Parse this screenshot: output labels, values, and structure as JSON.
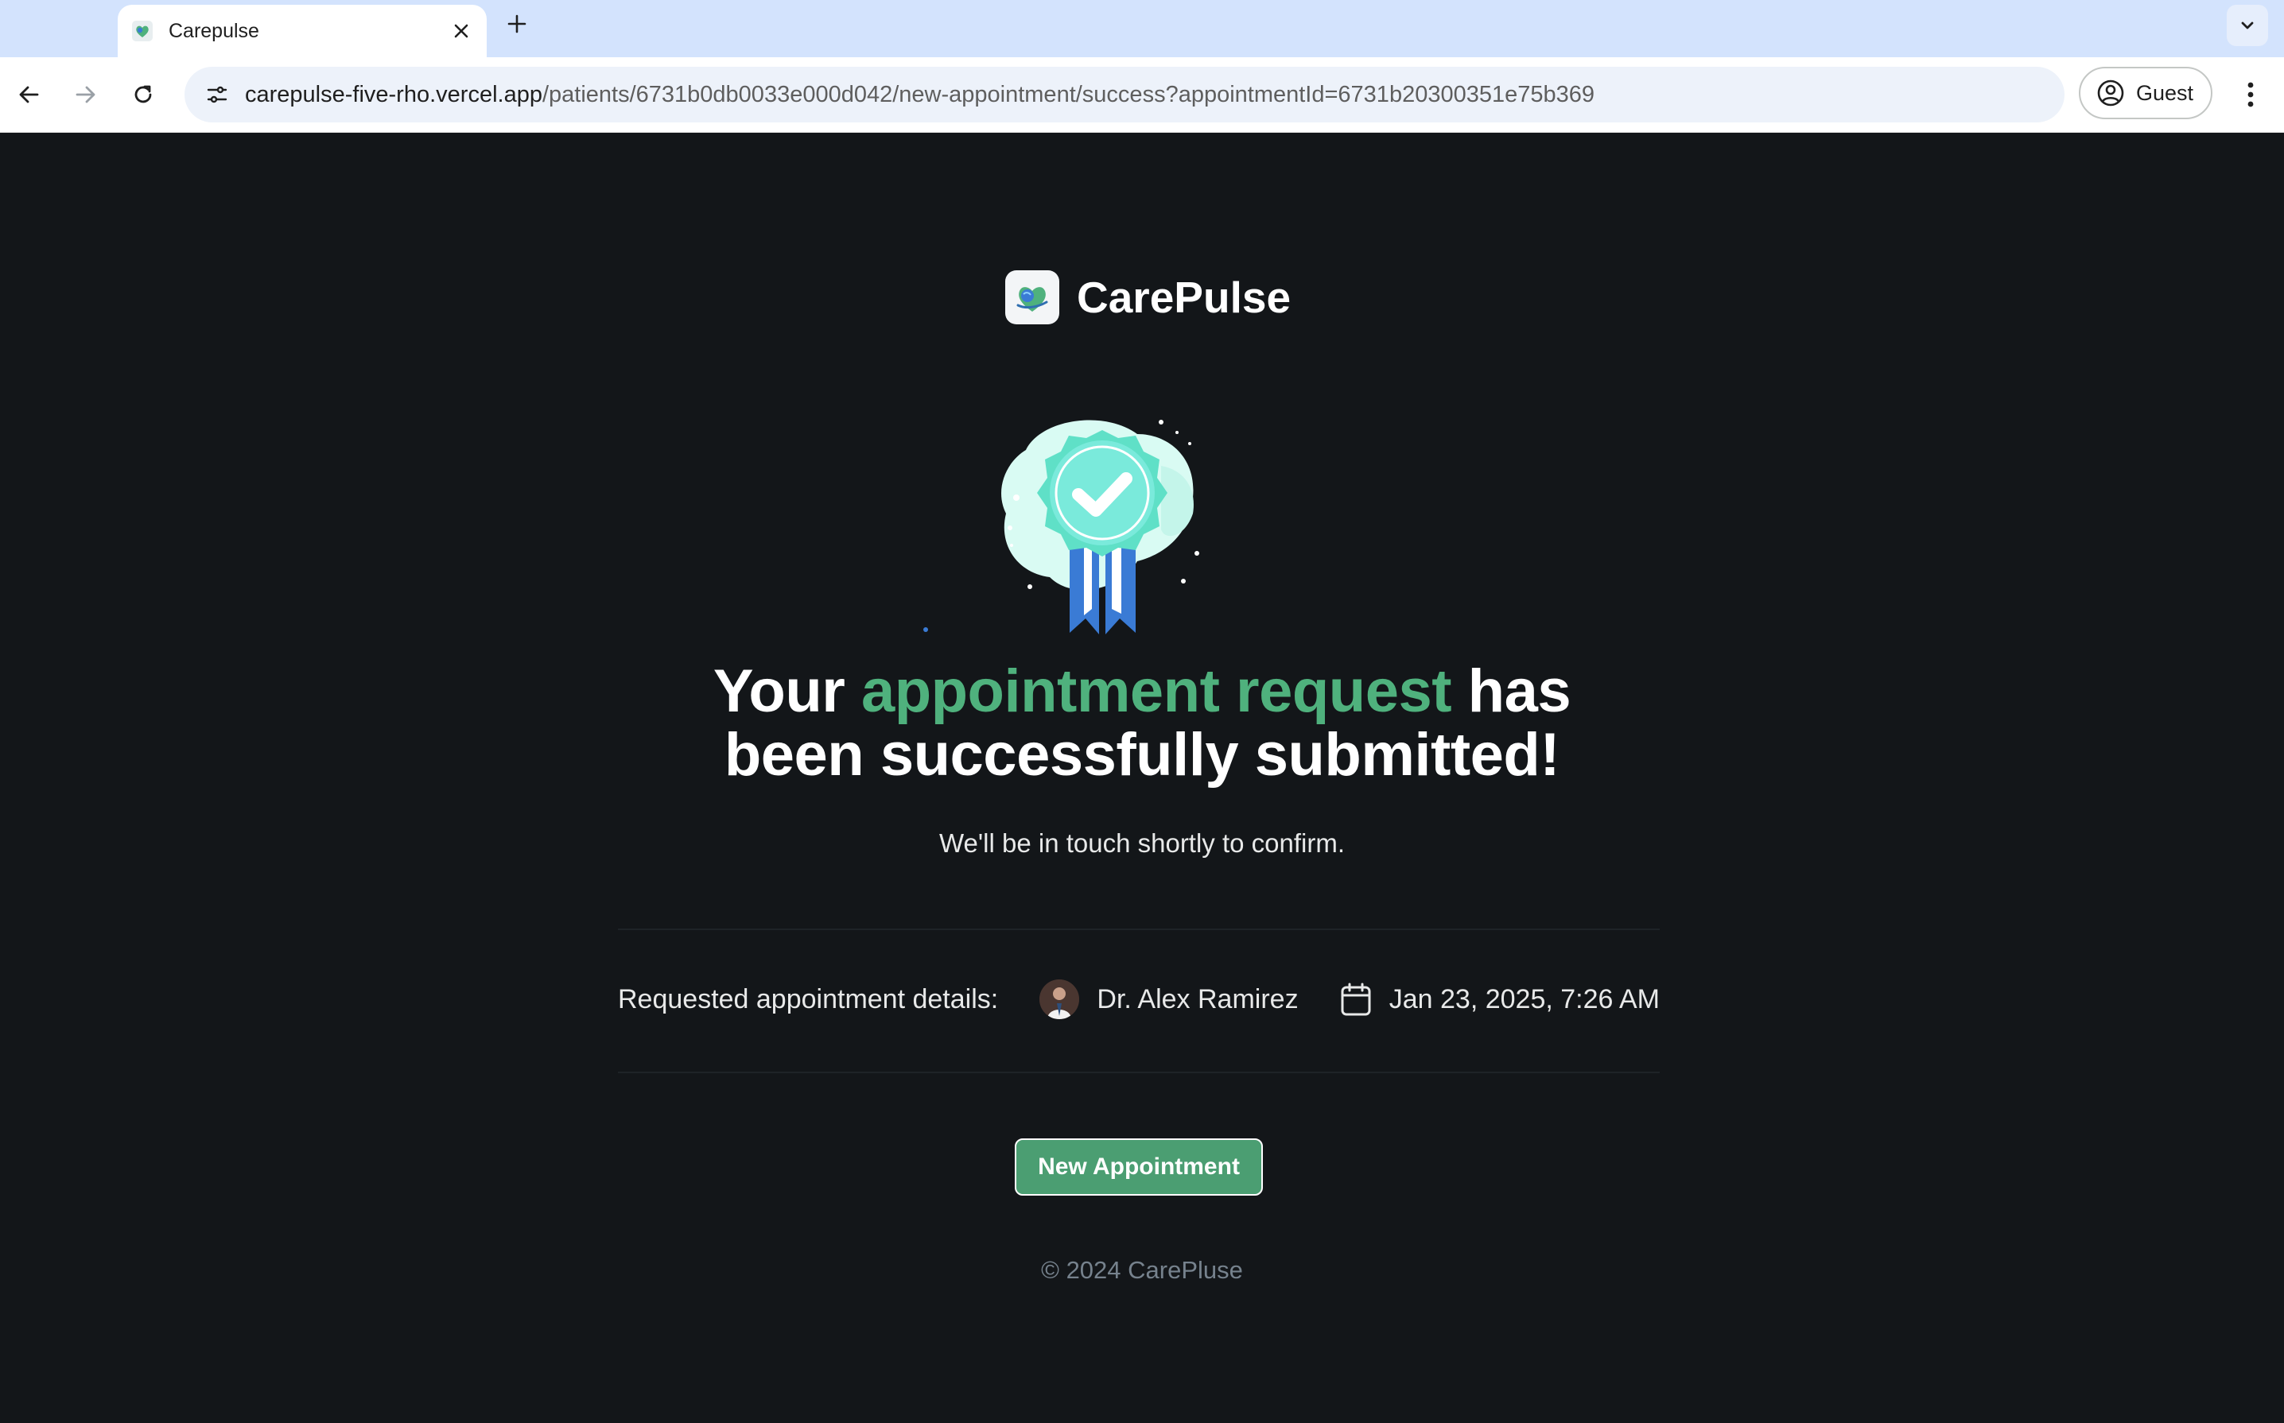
{
  "browser": {
    "tab_title": "Carepulse",
    "url_host": "carepulse-five-rho.vercel.app",
    "url_path": "/patients/6731b0db0033e000d042/new-appointment/success?appointmentId=6731b20300351e75b369",
    "profile_label": "Guest"
  },
  "logo": {
    "text": "CarePulse"
  },
  "headline": {
    "part1": "Your ",
    "accent": "appointment request",
    "part2": " has",
    "line2": "been successfully submitted!"
  },
  "subtext": "We'll be in touch shortly to confirm.",
  "details": {
    "label": "Requested appointment details:",
    "doctor": "Dr. Alex Ramirez",
    "datetime": "Jan 23, 2025, 7:26 AM"
  },
  "actions": {
    "new_appointment": "New Appointment"
  },
  "footer": "© 2024 CarePluse",
  "colors": {
    "background": "#131619",
    "accent_green": "#4fb17d",
    "button_green": "#4b9e72",
    "muted_text": "#76828d"
  },
  "icons": [
    "carepulse-favicon-icon",
    "close-icon",
    "plus-icon",
    "chevron-down-icon",
    "back-arrow-icon",
    "forward-arrow-icon",
    "reload-icon",
    "site-settings-icon",
    "account-circle-icon",
    "more-vert-icon",
    "carepulse-logo-icon",
    "success-badge-icon",
    "calendar-icon"
  ]
}
